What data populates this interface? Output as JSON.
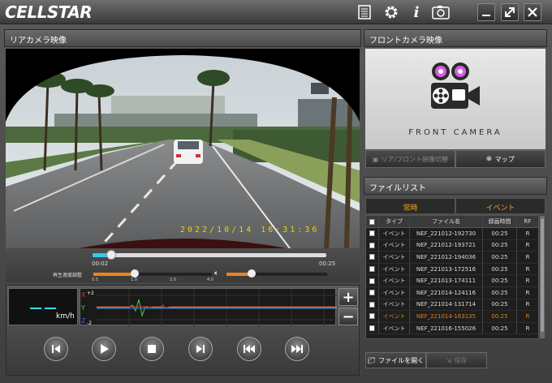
{
  "app": {
    "logo": "CELLSTAR"
  },
  "titlebar_icons": [
    "list-icon",
    "gear-icon",
    "info-icon",
    "camera-icon"
  ],
  "window_buttons": [
    "minimize",
    "maximize",
    "close"
  ],
  "rear": {
    "title": "リアカメラ映像",
    "timestamp": "2022/10/14  16:31:36",
    "elapsed": "00:02",
    "total": "00:25",
    "seek_progress": 0.08,
    "speed_label": "再生速度調整",
    "speed_ticks": [
      "0.5",
      "1.0",
      "2.0",
      "4.0"
    ],
    "speed_value": "1.0",
    "volume_level": 0.25
  },
  "gsensor": {
    "speed_unit": "km/h",
    "axes": [
      "X",
      "Y",
      "Z"
    ],
    "scale_top": "+2",
    "scale_bottom": "-2",
    "zoom_in": "+",
    "zoom_out": "−"
  },
  "controls": [
    "skip-start",
    "play",
    "stop",
    "skip-end",
    "prev-file",
    "next-file"
  ],
  "front": {
    "title": "フロントカメラ映像",
    "camera_label": "FRONT CAMERA",
    "switch_button": "リア/フロント映像切替",
    "map_button": "マップ"
  },
  "filelist": {
    "title": "ファイルリスト",
    "tabs": [
      "常時",
      "イベント"
    ],
    "columns": [
      "タイプ",
      "ファイル名",
      "録画時間",
      "RF"
    ],
    "rows": [
      {
        "type": "イベント",
        "name": "NEF_221012-192730",
        "time": "00:25",
        "rf": "R"
      },
      {
        "type": "イベント",
        "name": "NEF_221012-193721",
        "time": "00:25",
        "rf": "R"
      },
      {
        "type": "イベント",
        "name": "NEF_221012-194036",
        "time": "00:25",
        "rf": "R"
      },
      {
        "type": "イベント",
        "name": "NEF_221013-172516",
        "time": "00:25",
        "rf": "R"
      },
      {
        "type": "イベント",
        "name": "NEF_221013-174111",
        "time": "00:25",
        "rf": "R"
      },
      {
        "type": "イベント",
        "name": "NEF_221014-124116",
        "time": "00:25",
        "rf": "R"
      },
      {
        "type": "イベント",
        "name": "NEF_221014-131714",
        "time": "00:25",
        "rf": "R"
      },
      {
        "type": "イベント",
        "name": "NEF_221014-163135",
        "time": "00:25",
        "rf": "R",
        "selected": true
      },
      {
        "type": "イベント",
        "name": "NEF_221016-155026",
        "time": "00:25",
        "rf": "R"
      }
    ],
    "open_button": "ファイルを開く",
    "save_button": "保存"
  },
  "colors": {
    "accent": "#f5a020",
    "seek": "#35c8f0",
    "selected_row": "#e08020",
    "x_axis": "#e03030",
    "y_axis": "#30e030",
    "z_axis": "#4060f0"
  }
}
